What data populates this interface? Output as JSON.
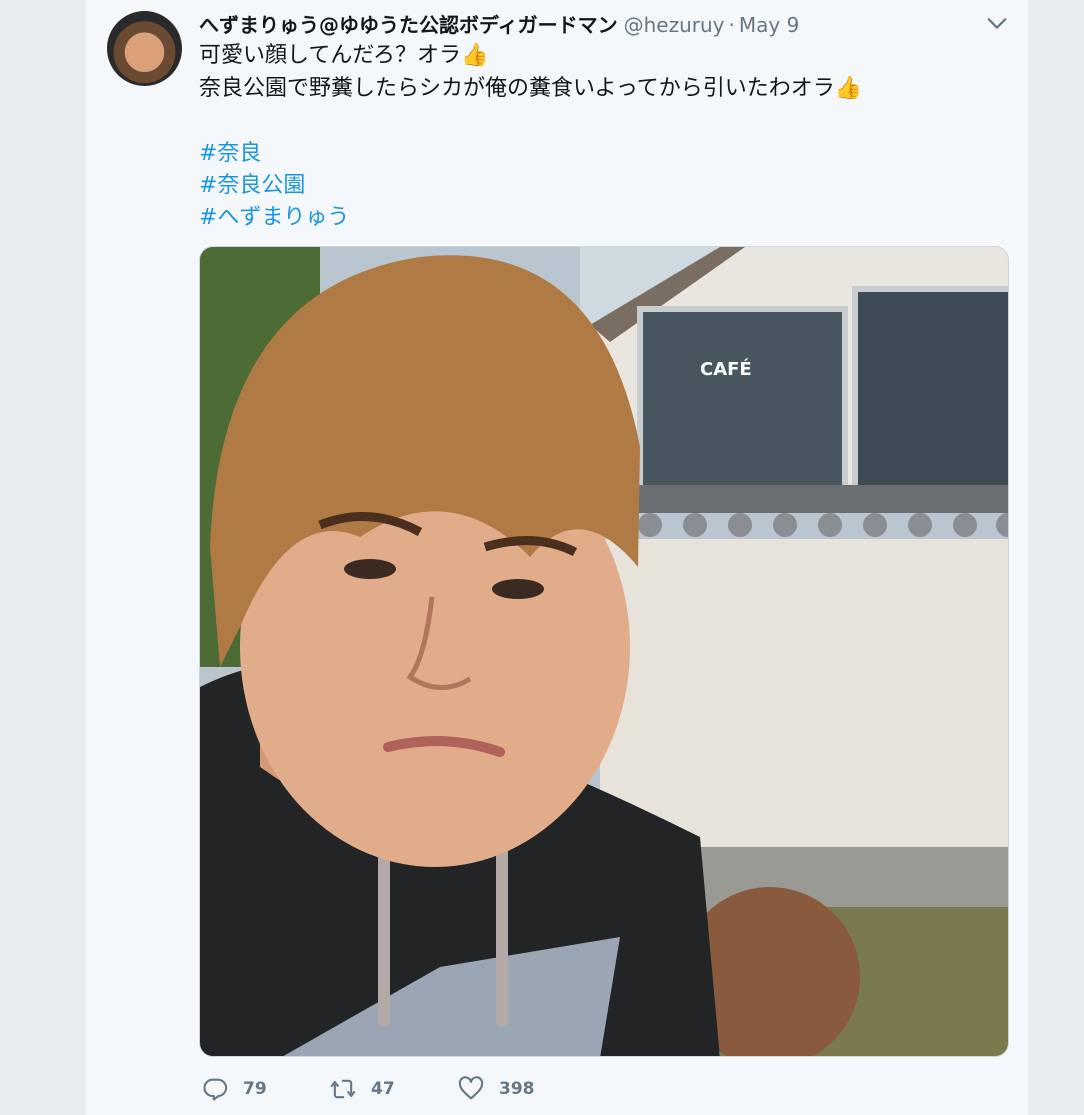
{
  "tweet": {
    "display_name": "へずまりゅう@ゆゆうた公認ボディガードマン",
    "handle": "@hezuruy",
    "separator": "·",
    "date": "May 9",
    "lines": [
      "可愛い顔してんだろ？オラ",
      "奈良公園で野糞したらシカが俺の糞食いよってから引いたわオラ"
    ],
    "emoji": "👍",
    "hashtags": [
      "#奈良",
      "#奈良公園",
      "#へずまりゅう"
    ],
    "photo_sign_text": "CAFÉ"
  },
  "actions": {
    "reply_count": "79",
    "retweet_count": "47",
    "like_count": "398"
  },
  "colors": {
    "hashtag": "#1b95e0",
    "secondary_text": "#657786",
    "primary_text": "#14171a"
  },
  "icons": [
    "chevron-down-icon",
    "reply-icon",
    "retweet-icon",
    "like-icon"
  ]
}
